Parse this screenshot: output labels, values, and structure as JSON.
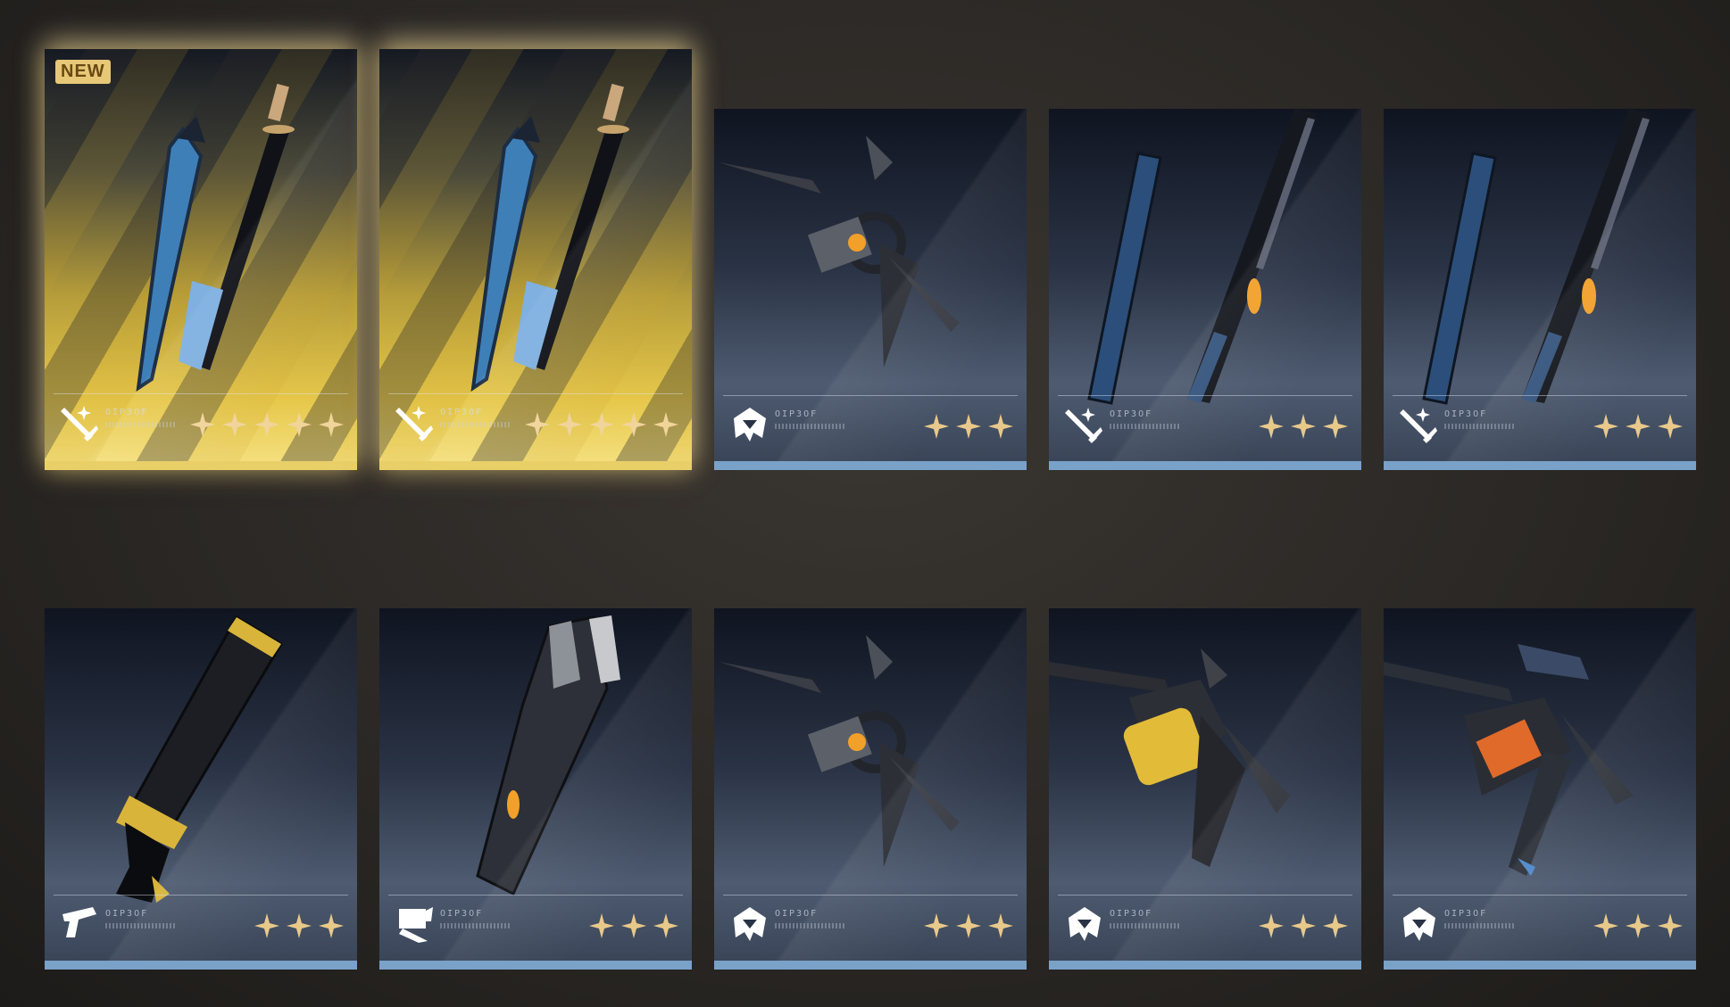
{
  "badge": {
    "new_label": "NEW"
  },
  "colors": {
    "gold_rarity": "#e9cf68",
    "blue_rarity": "#7aa1c8",
    "star": "#e8c98a"
  },
  "cards": [
    {
      "rarity": "gold",
      "new": true,
      "stars": 5,
      "type_icon": "sword-type-icon",
      "code": "OIP3OF",
      "weapon": "dual-blades"
    },
    {
      "rarity": "gold",
      "new": false,
      "stars": 5,
      "type_icon": "sword-type-icon",
      "code": "OIP3OF",
      "weapon": "dual-blades"
    },
    {
      "rarity": "blue",
      "new": false,
      "stars": 3,
      "type_icon": "gauntlet-type-icon",
      "code": "OIP3OF",
      "weapon": "claw-gauntlet"
    },
    {
      "rarity": "blue",
      "new": false,
      "stars": 3,
      "type_icon": "sword-type-icon",
      "code": "OIP3OF",
      "weapon": "twin-batons"
    },
    {
      "rarity": "blue",
      "new": false,
      "stars": 3,
      "type_icon": "sword-type-icon",
      "code": "OIP3OF",
      "weapon": "twin-batons"
    },
    {
      "rarity": "blue",
      "new": false,
      "stars": 3,
      "type_icon": "pistol-type-icon",
      "code": "OIP3OF",
      "weapon": "pistol"
    },
    {
      "rarity": "blue",
      "new": false,
      "stars": 3,
      "type_icon": "fist-type-icon",
      "code": "OIP3OF",
      "weapon": "rectifier"
    },
    {
      "rarity": "blue",
      "new": false,
      "stars": 3,
      "type_icon": "gauntlet-type-icon",
      "code": "OIP3OF",
      "weapon": "claw-gauntlet"
    },
    {
      "rarity": "blue",
      "new": false,
      "stars": 3,
      "type_icon": "gauntlet-type-icon",
      "code": "OIP3OF",
      "weapon": "gold-gauntlet"
    },
    {
      "rarity": "blue",
      "new": false,
      "stars": 3,
      "type_icon": "gauntlet-type-icon",
      "code": "OIP3OF",
      "weapon": "blue-gauntlet"
    }
  ]
}
